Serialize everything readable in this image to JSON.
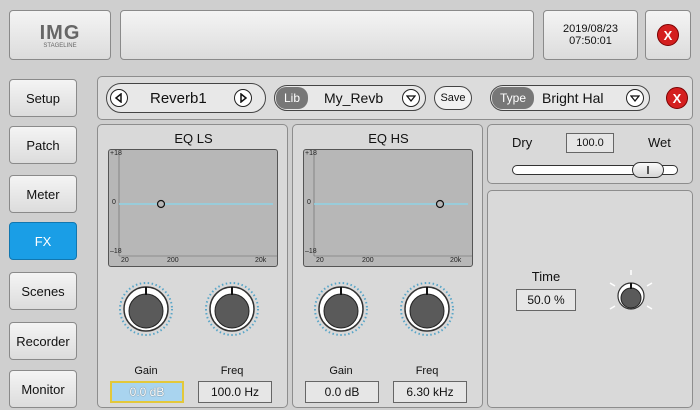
{
  "header": {
    "logo_text": "IMG",
    "logo_sub": "STAGELINE",
    "date": "2019/08/23",
    "time": "07:50:01",
    "close_label": "X"
  },
  "sidebar": {
    "items": [
      {
        "label": "Setup",
        "active": false
      },
      {
        "label": "Patch",
        "active": false
      },
      {
        "label": "Meter",
        "active": false
      },
      {
        "label": "FX",
        "active": true
      },
      {
        "label": "Scenes",
        "active": false
      },
      {
        "label": "Recorder",
        "active": false
      },
      {
        "label": "Monitor",
        "active": false
      }
    ]
  },
  "toolbar": {
    "fx_name": "Reverb1",
    "lib_label": "Lib",
    "lib_value": "My_Revb",
    "save_label": "Save",
    "type_label": "Type",
    "type_value": "Bright Hal",
    "close_label": "X"
  },
  "eq_ls": {
    "title": "EQ LS",
    "tick_top": "+18",
    "tick_mid": "0",
    "tick_bot": "–18",
    "x_ticks": [
      "20",
      "200",
      "20k"
    ],
    "gain_label": "Gain",
    "freq_label": "Freq",
    "gain_value": "0.0 dB",
    "freq_value": "100.0 Hz"
  },
  "eq_hs": {
    "title": "EQ HS",
    "tick_top": "+18",
    "tick_mid": "0",
    "tick_bot": "–18",
    "x_ticks": [
      "20",
      "200",
      "20k"
    ],
    "gain_label": "Gain",
    "freq_label": "Freq",
    "gain_value": "0.0 dB",
    "freq_value": "6.30 kHz"
  },
  "mix": {
    "dry_label": "Dry",
    "wet_label": "Wet",
    "value": "100.0",
    "level": 1.0
  },
  "reverb": {
    "time_label": "Time",
    "time_value": "50.0 %"
  },
  "colors": {
    "accent": "#1a9ee6",
    "close": "#d41f1f",
    "curve": "#8fd3e6",
    "selected_field": "#a9d4ef"
  }
}
